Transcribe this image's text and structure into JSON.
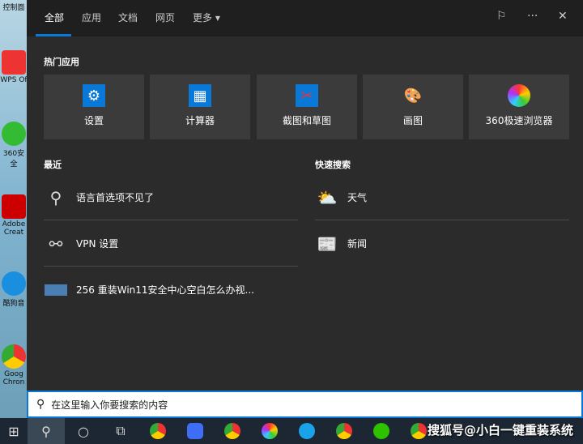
{
  "desktop": {
    "icons": [
      "控制面",
      "WPS Of",
      "360安全",
      "Adobe Creat",
      "酷狗音",
      "Goog Chron"
    ]
  },
  "tabs": [
    {
      "label": "全部"
    },
    {
      "label": "应用"
    },
    {
      "label": "文档"
    },
    {
      "label": "网页"
    },
    {
      "label": "更多 ▾"
    }
  ],
  "header_icons": [
    "feedback-icon",
    "more-icon",
    "close-icon"
  ],
  "top_apps": {
    "title": "热门应用",
    "items": [
      {
        "label": "设置",
        "icon": "gear-icon"
      },
      {
        "label": "计算器",
        "icon": "calculator-icon"
      },
      {
        "label": "截图和草图",
        "icon": "snip-icon"
      },
      {
        "label": "画图",
        "icon": "paint-icon"
      },
      {
        "label": "360极速浏览器",
        "icon": "browser-icon"
      }
    ]
  },
  "recent": {
    "title": "最近",
    "items": [
      {
        "label": "语言首选项不见了",
        "icon": "search-icon"
      },
      {
        "label": "VPN 设置",
        "icon": "vpn-icon"
      },
      {
        "label": "256 重装Win11安全中心空白怎么办视...",
        "icon": "video-thumb-icon"
      }
    ]
  },
  "quick": {
    "title": "快速搜索",
    "items": [
      {
        "label": "天气",
        "icon": "weather-icon"
      },
      {
        "label": "新闻",
        "icon": "news-icon"
      }
    ]
  },
  "search": {
    "placeholder": "在这里输入你要搜索的内容"
  },
  "accent": "#0a78d7",
  "watermark": "搜狐号@小白一键重装系统"
}
